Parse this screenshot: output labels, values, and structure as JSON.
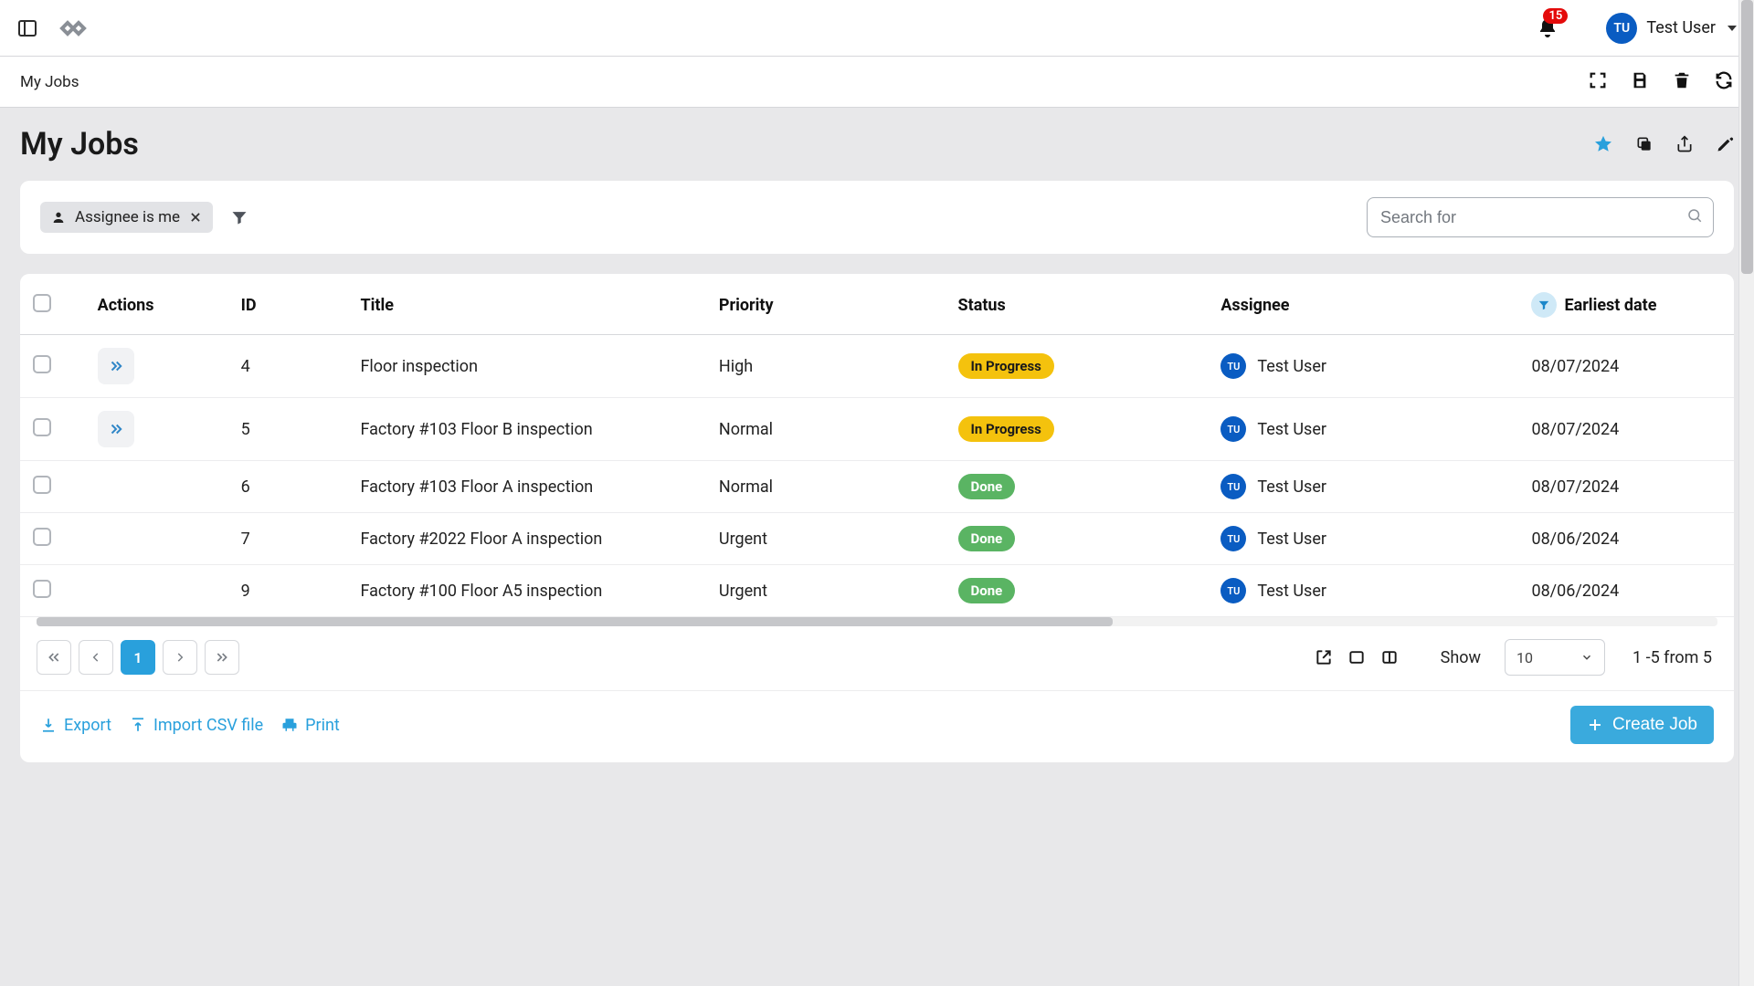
{
  "header": {
    "notification_count": "15",
    "user_initials": "TU",
    "user_name": "Test User"
  },
  "breadcrumb": {
    "label": "My Jobs"
  },
  "page": {
    "title": "My Jobs"
  },
  "filters": {
    "chip_label": "Assignee is me",
    "search_placeholder": "Search for"
  },
  "table": {
    "columns": {
      "actions": "Actions",
      "id": "ID",
      "title": "Title",
      "priority": "Priority",
      "status": "Status",
      "assignee": "Assignee",
      "earliest_date": "Earliest date"
    },
    "rows": [
      {
        "has_action": true,
        "id": "4",
        "title": "Floor inspection",
        "priority": "High",
        "status": {
          "label": "In Progress",
          "style": "inprogress"
        },
        "assignee": {
          "initials": "TU",
          "name": "Test User"
        },
        "date": "08/07/2024"
      },
      {
        "has_action": true,
        "id": "5",
        "title": "Factory #103 Floor B inspection",
        "priority": "Normal",
        "status": {
          "label": "In Progress",
          "style": "inprogress"
        },
        "assignee": {
          "initials": "TU",
          "name": "Test User"
        },
        "date": "08/07/2024"
      },
      {
        "has_action": false,
        "id": "6",
        "title": "Factory #103 Floor A inspection",
        "priority": "Normal",
        "status": {
          "label": "Done",
          "style": "done"
        },
        "assignee": {
          "initials": "TU",
          "name": "Test User"
        },
        "date": "08/07/2024"
      },
      {
        "has_action": false,
        "id": "7",
        "title": "Factory #2022 Floor A inspection",
        "priority": "Urgent",
        "status": {
          "label": "Done",
          "style": "done"
        },
        "assignee": {
          "initials": "TU",
          "name": "Test User"
        },
        "date": "08/06/2024"
      },
      {
        "has_action": false,
        "id": "9",
        "title": "Factory #100 Floor A5 inspection",
        "priority": "Urgent",
        "status": {
          "label": "Done",
          "style": "done"
        },
        "assignee": {
          "initials": "TU",
          "name": "Test User"
        },
        "date": "08/06/2024"
      }
    ]
  },
  "pagination": {
    "current": "1",
    "show_label": "Show",
    "page_size": "10",
    "range": "1 -5 from 5"
  },
  "footer": {
    "export": "Export",
    "import": "Import CSV file",
    "print": "Print",
    "create": "Create Job"
  }
}
